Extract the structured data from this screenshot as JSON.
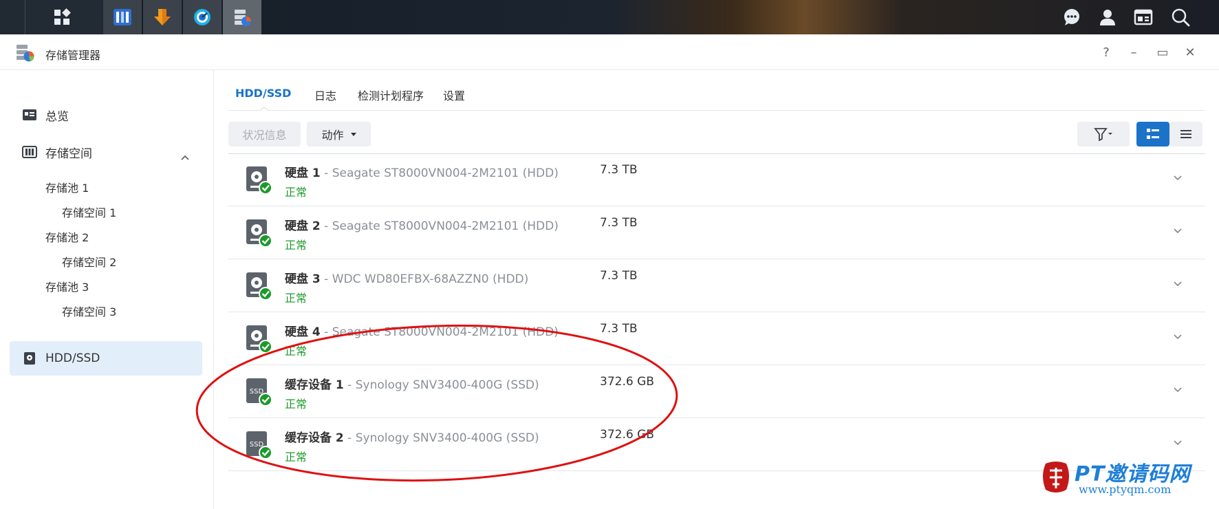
{
  "window": {
    "title": "存储管理器",
    "controls": [
      "?",
      "–",
      "▭",
      "✕"
    ]
  },
  "sidebar": {
    "items": [
      {
        "label": "总览",
        "icon": "overview-icon"
      },
      {
        "label": "存储空间",
        "icon": "storage-icon",
        "expanded": true
      },
      {
        "label": "HDD/SSD",
        "icon": "drive-icon",
        "selected": true
      }
    ],
    "pools": [
      {
        "label": "存储池 1",
        "volume": "存储空间 1"
      },
      {
        "label": "存储池 2",
        "volume": "存储空间 2"
      },
      {
        "label": "存储池 3",
        "volume": "存储空间 3"
      }
    ]
  },
  "tabs": [
    {
      "label": "HDD/SSD",
      "active": true
    },
    {
      "label": "日志"
    },
    {
      "label": "检测计划程序"
    },
    {
      "label": "设置"
    }
  ],
  "toolbar": {
    "status_info": "状况信息",
    "action": "动作"
  },
  "disks": [
    {
      "label": "硬盘",
      "num": "1",
      "model": "Seagate ST8000VN004-2M2101 (HDD)",
      "status": "正常",
      "size": "7.3 TB",
      "type": "hdd"
    },
    {
      "label": "硬盘",
      "num": "2",
      "model": "Seagate ST8000VN004-2M2101 (HDD)",
      "status": "正常",
      "size": "7.3 TB",
      "type": "hdd"
    },
    {
      "label": "硬盘",
      "num": "3",
      "model": "WDC WD80EFBX-68AZZN0 (HDD)",
      "status": "正常",
      "size": "7.3 TB",
      "type": "hdd"
    },
    {
      "label": "硬盘",
      "num": "4",
      "model": "Seagate ST8000VN004-2M2101 (HDD)",
      "status": "正常",
      "size": "7.3 TB",
      "type": "hdd"
    },
    {
      "label": "缓存设备",
      "num": "1",
      "model": "Synology SNV3400-400G (SSD)",
      "status": "正常",
      "size": "372.6 GB",
      "type": "ssd"
    },
    {
      "label": "缓存设备",
      "num": "2",
      "model": "Synology SNV3400-400G (SSD)",
      "status": "正常",
      "size": "372.6 GB",
      "type": "ssd"
    }
  ],
  "ssd_badge": "SSD",
  "watermark": {
    "title": "PT邀请码网",
    "url": "www.ptyqm.com"
  },
  "colors": {
    "accent": "#1a73c9",
    "status_ok": "#1b9a2a",
    "annotation": "#e01010"
  }
}
